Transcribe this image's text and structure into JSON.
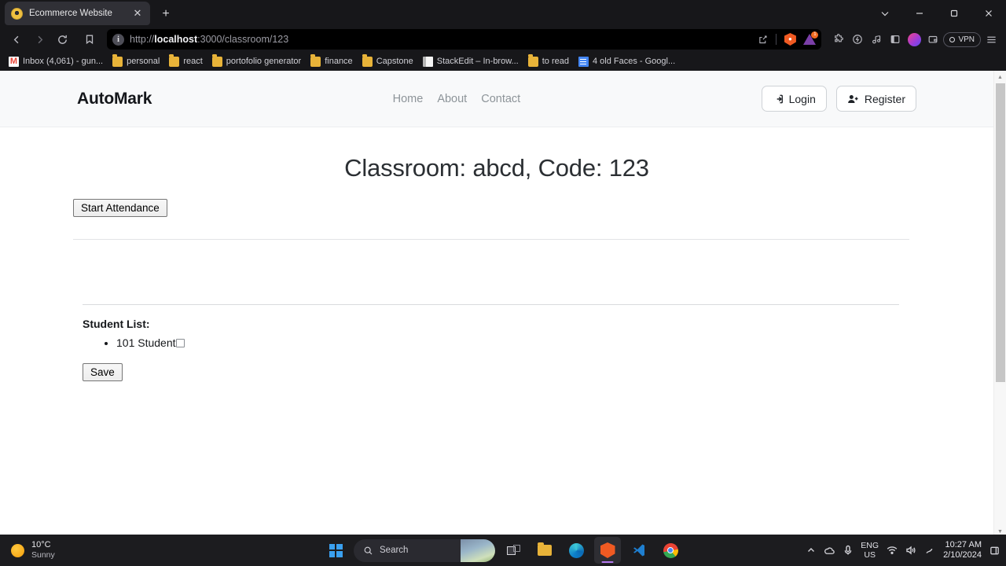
{
  "browser": {
    "tab": {
      "title": "Ecommerce Website",
      "favicon": "globe-favicon",
      "close": "✕"
    },
    "new_tab_label": "+",
    "window_controls": [
      "chevron-down-icon",
      "minimize-icon",
      "maximize-icon",
      "close-icon"
    ],
    "url": {
      "scheme": "http://",
      "host": "localhost",
      "rest": ":3000/classroom/123",
      "info_icon": "i"
    },
    "url_actions": [
      "share-icon",
      "brave-shields-icon",
      "extension-triangle-icon"
    ],
    "extension_badge": "1",
    "toolbar_right": [
      "extensions-puzzle-icon",
      "brave-rewards-icon",
      "brave-music-icon",
      "sidebar-icon",
      "leo-ai-icon",
      "brave-wallet-icon"
    ],
    "vpn_label": "VPN",
    "menu_icon": "hamburger-menu-icon",
    "bookmarks": [
      {
        "label": "Inbox (4,061) - gun...",
        "icon": "gmail-icon"
      },
      {
        "label": "personal",
        "icon": "folder-icon"
      },
      {
        "label": "react",
        "icon": "folder-icon"
      },
      {
        "label": "portofolio generator",
        "icon": "folder-icon"
      },
      {
        "label": "finance",
        "icon": "folder-icon"
      },
      {
        "label": "Capstone",
        "icon": "folder-icon"
      },
      {
        "label": "StackEdit – In-brow...",
        "icon": "stackedit-icon"
      },
      {
        "label": "to read",
        "icon": "folder-icon"
      },
      {
        "label": "4 old Faces - Googl...",
        "icon": "google-docs-icon"
      }
    ]
  },
  "site": {
    "brand": "AutoMark",
    "nav_links": [
      {
        "label": "Home"
      },
      {
        "label": "About"
      },
      {
        "label": "Contact"
      }
    ],
    "login_label": "Login",
    "register_label": "Register"
  },
  "main": {
    "title": "Classroom: abcd, Code: 123",
    "classroom_name": "abcd",
    "classroom_code": "123",
    "start_attendance_label": "Start Attendance",
    "student_list_heading": "Student List:",
    "students": [
      {
        "label": "101 Student",
        "checked": false
      }
    ],
    "save_label": "Save"
  },
  "taskbar": {
    "weather": {
      "temperature": "10°C",
      "condition": "Sunny"
    },
    "start_label": "start-button",
    "search_placeholder": "Search",
    "apps": [
      {
        "name": "task-view",
        "icon": "task-view-icon",
        "active": false
      },
      {
        "name": "file-explorer",
        "icon": "file-explorer-icon",
        "active": false
      },
      {
        "name": "microsoft-edge",
        "icon": "edge-icon",
        "active": false
      },
      {
        "name": "brave-browser",
        "icon": "brave-icon",
        "active": true
      },
      {
        "name": "vs-code",
        "icon": "vscode-icon",
        "active": false
      },
      {
        "name": "google-chrome",
        "icon": "chrome-icon",
        "active": false
      }
    ],
    "tray": {
      "overflow": "show-hidden-icons-chevron",
      "onedrive": "onedrive-icon",
      "mic": "microphone-icon",
      "language_line1": "ENG",
      "language_line2": "US",
      "wifi": "wifi-icon",
      "volume": "volume-icon",
      "battery": "battery-icon",
      "time": "10:27 AM",
      "date": "2/10/2024",
      "notifications": "notification-icon"
    }
  }
}
